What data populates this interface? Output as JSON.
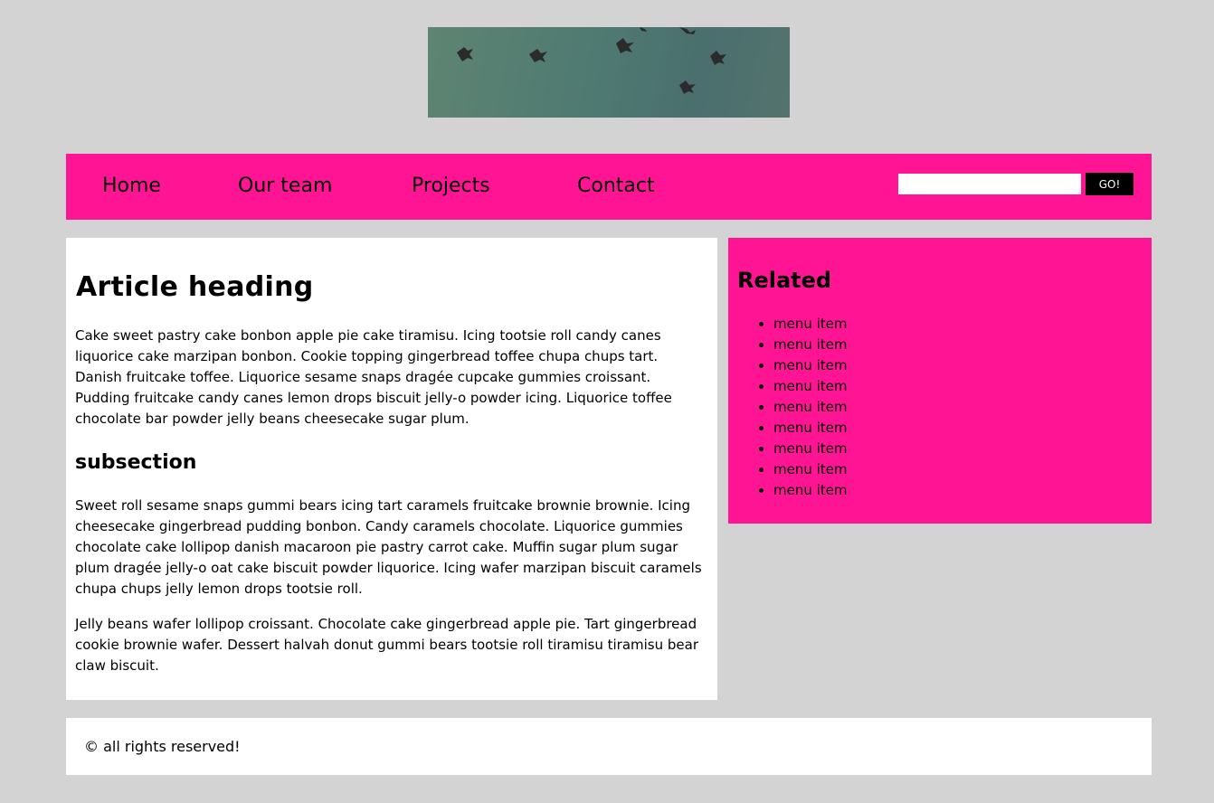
{
  "header": {
    "banner_image": "flying-birds-photo"
  },
  "nav": {
    "items": [
      {
        "label": "Home"
      },
      {
        "label": "Our team"
      },
      {
        "label": "Projects"
      },
      {
        "label": "Contact"
      }
    ],
    "search": {
      "value": "",
      "placeholder": ""
    },
    "search_button_label": "GO!"
  },
  "article": {
    "heading": "Article heading",
    "paragraph1": "Cake sweet pastry cake bonbon apple pie cake tiramisu. Icing tootsie roll candy canes liquorice cake marzipan bonbon. Cookie topping gingerbread toffee chupa chups tart. Danish fruitcake toffee. Liquorice sesame snaps dragée cupcake gummies croissant. Pudding fruitcake candy canes lemon drops biscuit jelly-o powder icing. Liquorice toffee chocolate bar powder jelly beans cheesecake sugar plum.",
    "subheading": "subsection",
    "paragraph2": "Sweet roll sesame snaps gummi bears icing tart caramels fruitcake brownie brownie. Icing cheesecake gingerbread pudding bonbon. Candy caramels chocolate. Liquorice gummies chocolate cake lollipop danish macaroon pie pastry carrot cake. Muffin sugar plum sugar plum dragée jelly-o oat cake biscuit powder liquorice. Icing wafer marzipan biscuit caramels chupa chups jelly lemon drops tootsie roll.",
    "paragraph3": "Jelly beans wafer lollipop croissant. Chocolate cake gingerbread apple pie. Tart gingerbread cookie brownie wafer. Dessert halvah donut gummi bears tootsie roll tiramisu tiramisu bear claw biscuit."
  },
  "related": {
    "heading": "Related",
    "items": [
      {
        "label": "menu item"
      },
      {
        "label": "menu item"
      },
      {
        "label": "menu item"
      },
      {
        "label": "menu item"
      },
      {
        "label": "menu item"
      },
      {
        "label": "menu item"
      },
      {
        "label": "menu item"
      },
      {
        "label": "menu item"
      },
      {
        "label": "menu item"
      }
    ]
  },
  "footer": {
    "text": "© all rights reserved!"
  },
  "colors": {
    "page_background": "#d3d3d3",
    "accent": "#ff1493",
    "panel": "#ffffff",
    "button": "#000000"
  }
}
